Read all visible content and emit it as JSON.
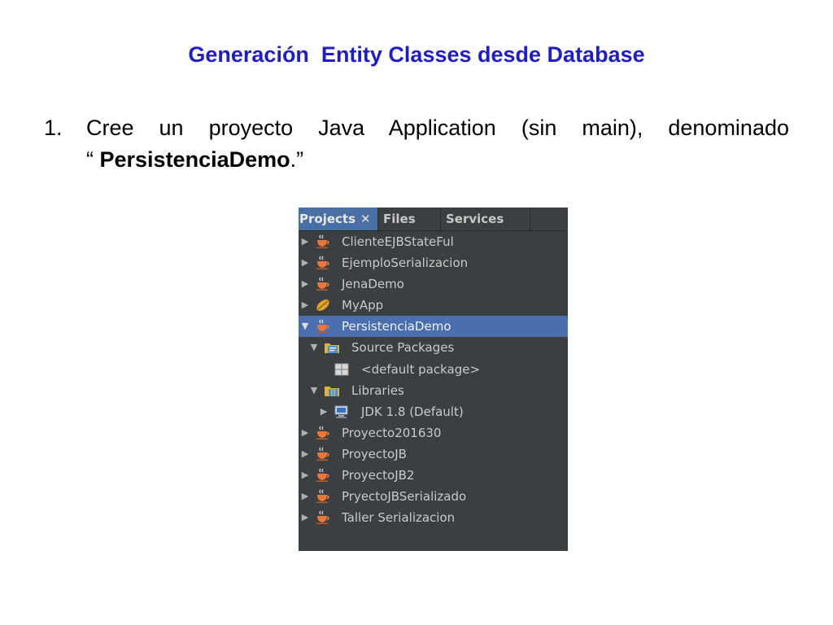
{
  "slide": {
    "title": "Generación  Entity Classes desde Database",
    "step_number": "1.",
    "step_text_line1": "Cree un proyecto Java Application (sin main), denominado",
    "step_text_prefix": "“ ",
    "step_text_bold": "PersistenciaDemo",
    "step_text_suffix": ".”"
  },
  "ide": {
    "tabs": [
      {
        "label": "Projects",
        "close": "✕",
        "active": true
      },
      {
        "label": "Files",
        "active": false
      },
      {
        "label": "Services",
        "active": false
      }
    ],
    "tree": [
      {
        "label": "ClienteEJBStateFul",
        "icon": "java-cup-icon",
        "expanded": false,
        "selected": false
      },
      {
        "label": "EjemploSerializacion",
        "icon": "java-cup-icon",
        "expanded": false,
        "selected": false
      },
      {
        "label": "JenaDemo",
        "icon": "java-cup-icon",
        "expanded": false,
        "selected": false
      },
      {
        "label": "MyApp",
        "icon": "bean-icon",
        "expanded": false,
        "selected": false
      },
      {
        "label": "PersistenciaDemo",
        "icon": "java-cup-icon",
        "expanded": true,
        "selected": true
      },
      {
        "label": "Source Packages",
        "icon": "source-packages-icon",
        "expanded": true,
        "selected": false
      },
      {
        "label": "<default package>",
        "icon": "package-icon",
        "expanded": null,
        "selected": false
      },
      {
        "label": "Libraries",
        "icon": "libraries-icon",
        "expanded": true,
        "selected": false
      },
      {
        "label": "JDK 1.8 (Default)",
        "icon": "jdk-icon",
        "expanded": false,
        "selected": false
      },
      {
        "label": "Proyecto201630",
        "icon": "java-cup-icon",
        "expanded": false,
        "selected": false
      },
      {
        "label": "ProyectoJB",
        "icon": "java-cup-icon",
        "expanded": false,
        "selected": false
      },
      {
        "label": "ProyectoJB2",
        "icon": "java-cup-icon",
        "expanded": false,
        "selected": false
      },
      {
        "label": "PryectoJBSerializado",
        "icon": "java-cup-icon",
        "expanded": false,
        "selected": false
      },
      {
        "label": "Taller Serializacion",
        "icon": "java-cup-icon",
        "expanded": false,
        "selected": false
      }
    ],
    "colors": {
      "panel_bg": "#3c3f41",
      "selection": "#4b6eaf",
      "title_blue": "#1f1fbf"
    }
  }
}
